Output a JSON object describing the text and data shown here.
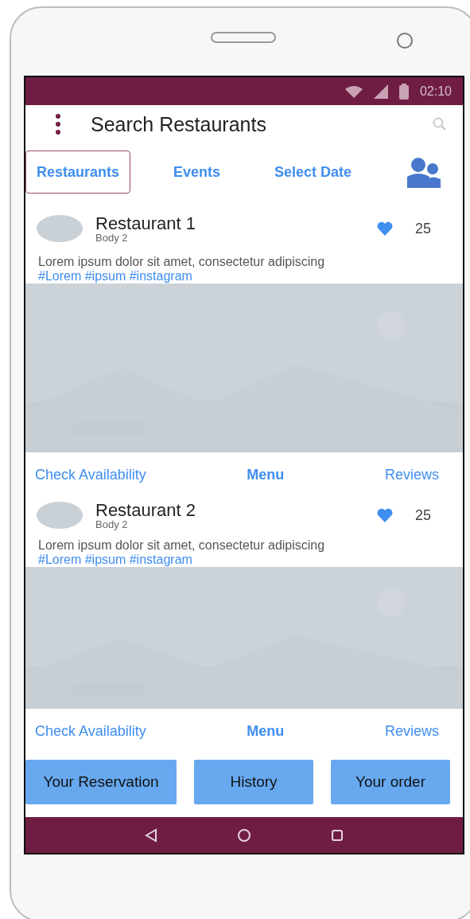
{
  "status_bar": {
    "time": "02:10"
  },
  "header": {
    "title": "Search Restaurants"
  },
  "tabs": [
    {
      "label": "Restaurants",
      "selected": true
    },
    {
      "label": "Events",
      "selected": false
    },
    {
      "label": "Select Date",
      "selected": false
    }
  ],
  "cards": [
    {
      "title": "Restaurant 1",
      "subtitle": "Body 2",
      "likes": "25",
      "text": "Lorem ipsum dolor sit amet, consectetur adipiscing",
      "tags": "#Lorem #ipsum #instagram",
      "actions": [
        "Check Availability",
        "Menu",
        "Reviews"
      ]
    },
    {
      "title": "Restaurant 2",
      "subtitle": "Body 2",
      "likes": "25",
      "text": "Lorem ipsum dolor sit amet, consectetur adipiscing",
      "tags": "#Lorem #ipsum #instagram",
      "actions": [
        "Check Availability",
        "Menu",
        "Reviews"
      ]
    }
  ],
  "bottom_buttons": [
    "Your Reservation",
    "History",
    "Your order"
  ]
}
